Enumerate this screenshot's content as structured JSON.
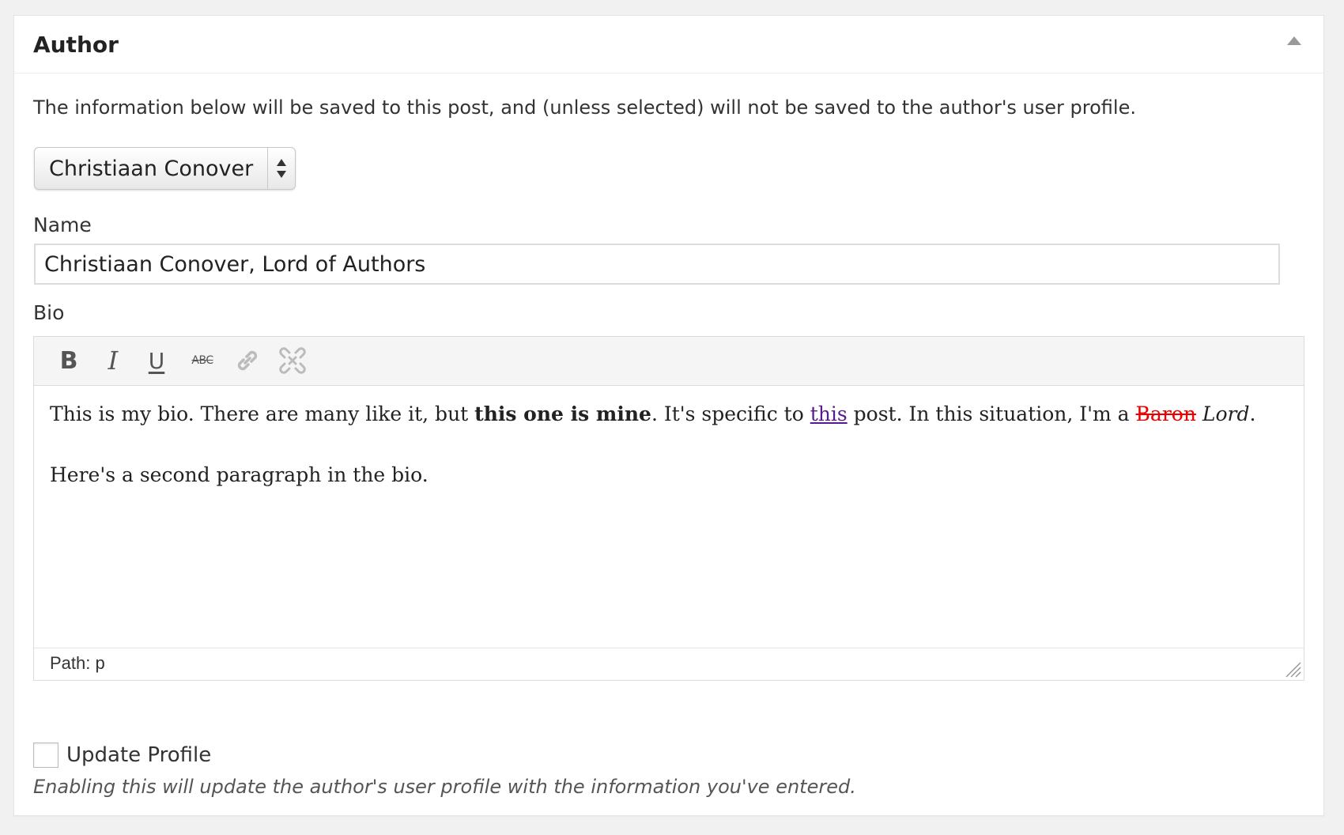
{
  "metabox": {
    "title": "Author",
    "toggle_icon": "triangle-up-icon"
  },
  "info_text": "The information below will be saved to this post, and (unless selected) will not be saved to the author's user profile.",
  "author_select": {
    "selected": "Christiaan Conover"
  },
  "name_field": {
    "label": "Name",
    "value": "Christiaan Conover, Lord of Authors"
  },
  "bio_field": {
    "label": "Bio",
    "toolbar": {
      "bold": "B",
      "italic": "I",
      "underline": "U",
      "strikethrough": "ABC",
      "link_icon": "link-icon",
      "unlink_icon": "unlink-icon"
    },
    "content": {
      "p1_part1": "This is my bio. There are many like it, but ",
      "p1_bold": "this one is mine",
      "p1_part2": ". It's specific to ",
      "p1_link": "this",
      "p1_part3": " post. In this situation, I'm a ",
      "p1_strike": "Baron",
      "p1_space": " ",
      "p1_italic": "Lord",
      "p1_end": ".",
      "p2": "Here's a second paragraph in the bio."
    },
    "status_path": "Path: p"
  },
  "update_profile": {
    "label": "Update Profile",
    "checked": false,
    "description": "Enabling this will update the author's user profile with the information you've entered."
  },
  "colors": {
    "link": "#551a8b",
    "strike": "#ee0000",
    "toolbar_bg": "#f5f5f5",
    "page_bg": "#f1f1f1"
  }
}
